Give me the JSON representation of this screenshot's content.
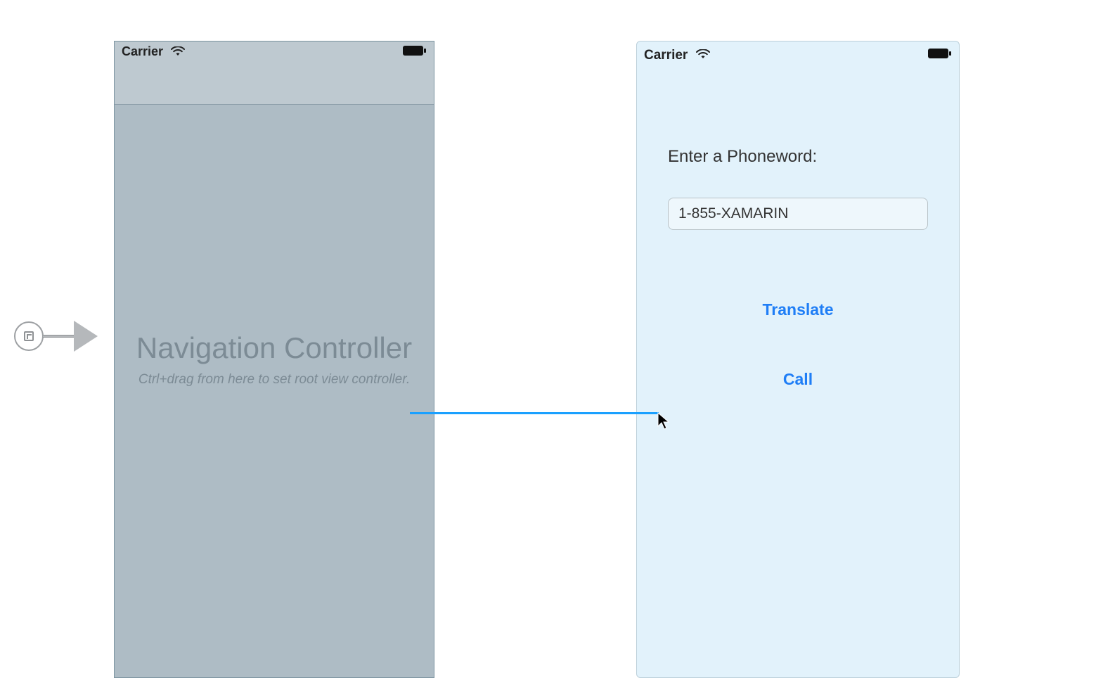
{
  "statusbar": {
    "carrier": "Carrier"
  },
  "nav_controller": {
    "title": "Navigation Controller",
    "hint": "Ctrl+drag from here to set root view controller."
  },
  "phoneword_view": {
    "prompt_label": "Enter a Phoneword:",
    "input_value": "1-855-XAMARIN",
    "translate_label": "Translate",
    "call_label": "Call"
  }
}
